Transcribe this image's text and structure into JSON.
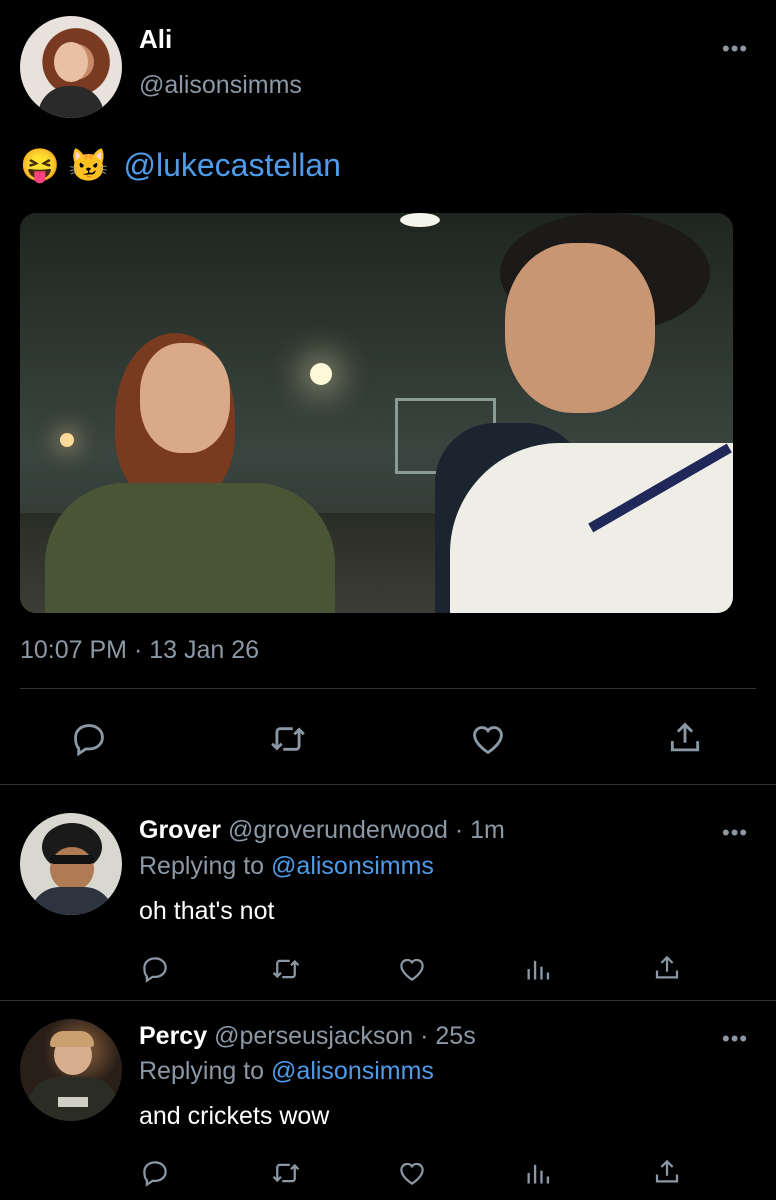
{
  "tweet": {
    "display_name": "Ali",
    "handle": "@alisonsimms",
    "emoji": "😝 😼",
    "mention": "@lukecastellan",
    "timestamp": "10:07 PM · 13 Jan 26"
  },
  "actions_icons": [
    "reply-icon",
    "retweet-icon",
    "like-icon",
    "share-icon"
  ],
  "replies": [
    {
      "display_name": "Grover",
      "handle": "@groverunderwood",
      "age": "· 1m",
      "replying_prefix": "Replying to",
      "replying_to": "@alisonsimms",
      "text": "oh that's not"
    },
    {
      "display_name": "Percy",
      "handle": "@perseusjackson",
      "age": "· 25s",
      "replying_prefix": "Replying to",
      "replying_to": "@alisonsimms",
      "text": "and crickets wow"
    }
  ],
  "more_glyph": "•••",
  "colors": {
    "background": "#000000",
    "link": "#4e9be9",
    "muted": "#8b98a5"
  }
}
